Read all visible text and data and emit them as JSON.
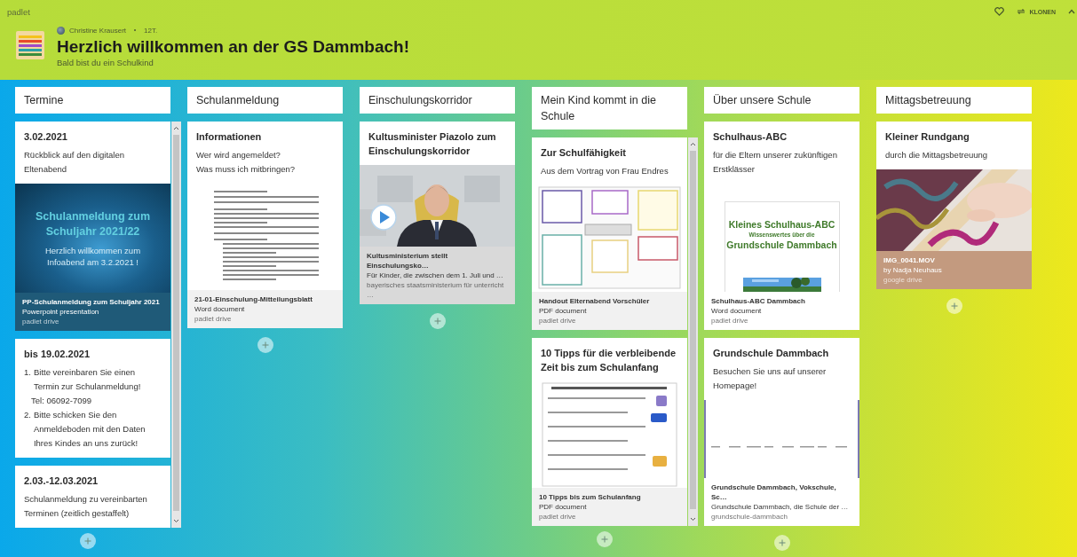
{
  "app": {
    "brand": "padlet",
    "actions": {
      "clone": "KLONEN"
    }
  },
  "header": {
    "author": "Christine Krausert",
    "time": "12T.",
    "title": "Herzlich willkommen an der GS Dammbach!",
    "subtitle": "Bald bist du ein Schulkind"
  },
  "columns": [
    {
      "title": "Termine",
      "scrollable": true,
      "cards": [
        {
          "title": "3.02.2021",
          "body": [
            {
              "kind": "text",
              "text": "Rückblick auf den digitalen Eltenabend"
            }
          ],
          "attachment": {
            "preview": {
              "kind": "slide",
              "lines": [
                {
                  "kind": "heading",
                  "text": "Schulanmeldung zum Schuljahr 2021/22"
                },
                {
                  "kind": "text",
                  "text": "Herzlich willkommen zum Infoabend am 3.2.2021 !"
                }
              ]
            },
            "title": "PP-Schulanmeldung zum Schuljahr 2021",
            "subtitle": "Powerpoint presentation",
            "source": "padlet drive",
            "color": "#1f5a78"
          }
        },
        {
          "title": "bis 19.02.2021",
          "body": [
            {
              "kind": "item",
              "marker": "1.",
              "text": "Bitte vereinbaren Sie einen Termin zur Schulanmeldung!"
            },
            {
              "kind": "note",
              "text": "Tel: 06092-7099"
            },
            {
              "kind": "item",
              "marker": "2.",
              "text": "Bitte schicken Sie den Anmeldeboden mit den Daten Ihres Kindes an uns zurück!"
            }
          ]
        },
        {
          "title": "2.03.-12.03.2021",
          "body": [
            {
              "kind": "text",
              "text": "Schulanmeldung zu vereinbarten Terminen (zeitlich gestaffelt)"
            }
          ]
        }
      ]
    },
    {
      "title": "Schulanmeldung",
      "scrollable": false,
      "cards": [
        {
          "title": "Informationen",
          "body": [
            {
              "kind": "text",
              "text": "Wer wird angemeldet?"
            },
            {
              "kind": "text",
              "text": "Was muss ich mitbringen?"
            }
          ],
          "attachment": {
            "preview": {
              "kind": "document"
            },
            "title": "21-01-Einschulung-Mitteilungsblatt",
            "subtitle": "Word document",
            "source": "padlet drive",
            "color": "#f1f1f1"
          }
        }
      ]
    },
    {
      "title": "Einschulungskorridor",
      "scrollable": false,
      "cards": [
        {
          "title": "Kultusminister Piazolo zum Einschulungskorridor",
          "attachment": {
            "preview": {
              "kind": "video"
            },
            "title": "Kultusministerium stellt Einschulungsko…",
            "subtitle": "Für Kinder, die zwischen dem 1. Juli und …",
            "source": "bayerisches staatsministerium für unterricht …",
            "color": "#d9d9d9"
          }
        }
      ]
    },
    {
      "title": "Mein Kind kommt in die Schule",
      "scrollable": true,
      "cards": [
        {
          "title": "Zur Schulfähigkeit",
          "body": [
            {
              "kind": "text",
              "text": "Aus dem Vortrag von Frau Endres"
            }
          ],
          "attachment": {
            "preview": {
              "kind": "document"
            },
            "title": "Handout Elternabend Vorschüler",
            "subtitle": "PDF document",
            "source": "padlet drive",
            "color": "#f1f1f1"
          }
        },
        {
          "title": "10 Tipps für die verbleibende Zeit bis zum Schulanfang",
          "attachment": {
            "preview": {
              "kind": "document"
            },
            "title": "10 Tipps bis zum Schulanfang",
            "subtitle": "PDF document",
            "source": "padlet drive",
            "color": "#f1f1f1"
          }
        }
      ]
    },
    {
      "title": "Über unsere Schule",
      "scrollable": false,
      "cards": [
        {
          "title": "Schulhaus-ABC",
          "body": [
            {
              "kind": "text",
              "text": "für die Eltern unserer zukünftigen Erstklässer"
            }
          ],
          "attachment": {
            "preview": {
              "kind": "cover",
              "lines": [
                {
                  "kind": "heading",
                  "text": "Kleines Schulhaus-ABC"
                },
                {
                  "kind": "text",
                  "text": "Wissenswertes über die"
                },
                {
                  "kind": "heading",
                  "text": "Grundschule Dammbach"
                }
              ]
            },
            "title": "Schulhaus-ABC Dammbach",
            "subtitle": "Word document",
            "source": "padlet drive",
            "color": "#ffffff"
          }
        },
        {
          "title": "Grundschule Dammbach",
          "body": [
            {
              "kind": "text",
              "text": "Besuchen Sie uns auf unserer Homepage!"
            }
          ],
          "attachment": {
            "preview": {
              "kind": "website"
            },
            "title": "Grundschule Dammbach, Vokschule, Sc…",
            "subtitle": "Grundschule Dammbach, die Schule der …",
            "source": "grundschule-dammbach",
            "color": "#ffffff"
          }
        }
      ]
    },
    {
      "title": "Mittagsbetreuung",
      "scrollable": false,
      "cards": [
        {
          "title": "Kleiner Rundgang",
          "body": [
            {
              "kind": "text",
              "text": "durch die Mittagsbetreuung"
            }
          ],
          "attachment": {
            "title": "IMG_0041.MOV",
            "subtitle": "by Nadja Neuhaus",
            "source": "google drive",
            "color": "#c39a7f"
          }
        }
      ]
    }
  ]
}
